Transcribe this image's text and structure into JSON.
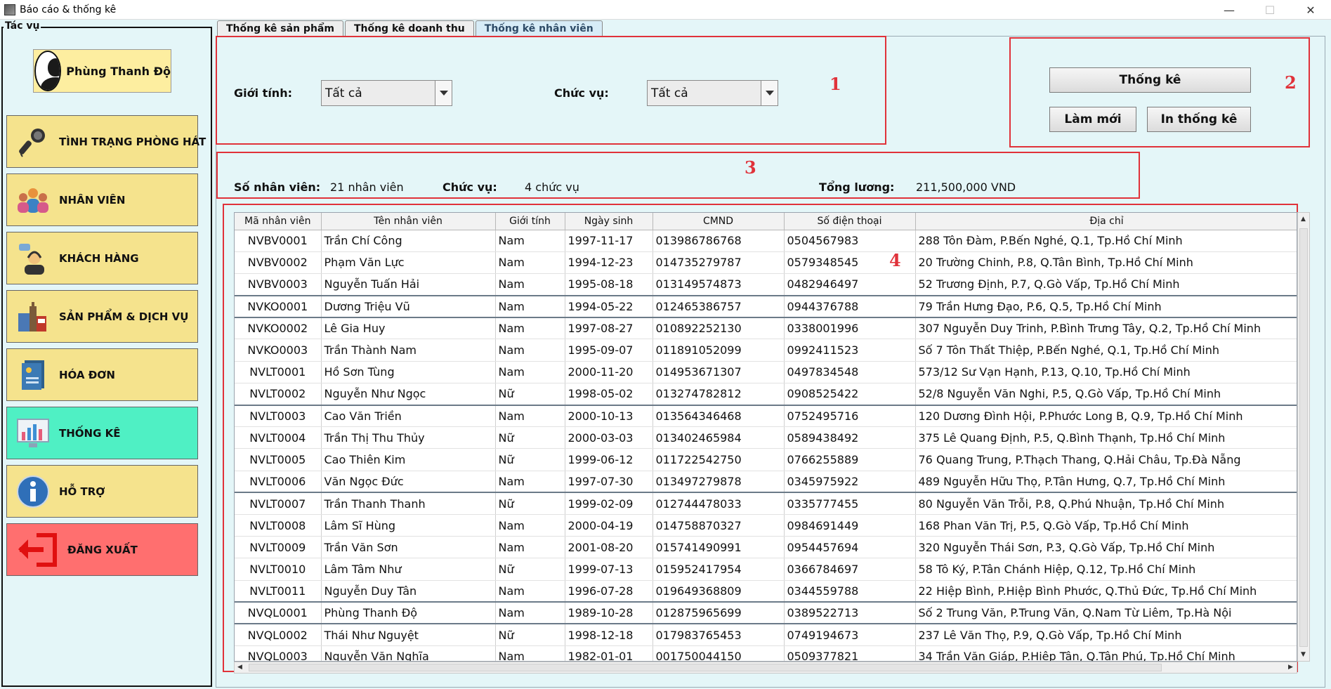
{
  "window": {
    "title": "Báo cáo & thống kê",
    "minimize": "—",
    "maximize": "☐",
    "close": "✕"
  },
  "sidebar": {
    "legend": "Tác vụ",
    "user_name": "Phùng Thanh Độ",
    "items": [
      {
        "label": "TÌNH TRẠNG PHÒNG HÁT",
        "icon": "microphone-icon"
      },
      {
        "label": "NHÂN VIÊN",
        "icon": "staff-group-icon"
      },
      {
        "label": "KHÁCH HÀNG",
        "icon": "customer-support-icon"
      },
      {
        "label": "SẢN PHẨM & DỊCH VỤ",
        "icon": "products-icon"
      },
      {
        "label": "HÓA ĐƠN",
        "icon": "invoice-icon"
      },
      {
        "label": "THỐNG KÊ",
        "icon": "statistics-chart-icon"
      },
      {
        "label": "HỖ TRỢ",
        "icon": "info-icon"
      },
      {
        "label": "ĐĂNG XUẤT",
        "icon": "logout-icon"
      }
    ]
  },
  "tabs": [
    {
      "label": "Thống kê sản phẩm",
      "active": false
    },
    {
      "label": "Thống kê doanh thu",
      "active": false
    },
    {
      "label": "Thống kê nhân viên",
      "active": true
    }
  ],
  "filters": {
    "gender_label": "Giới tính:",
    "gender_value": "Tất cả",
    "position_label": "Chức vụ:",
    "position_value": "Tất cả"
  },
  "annotations": {
    "n1": "1",
    "n2": "2",
    "n3": "3",
    "n4": "4"
  },
  "actions": {
    "stats_label": "Thống kê",
    "refresh_label": "Làm mới",
    "print_label": "In thống kê"
  },
  "summary": {
    "employees_label": "Số nhân viên:",
    "employees_value": "21 nhân viên",
    "positions_label": "Chức vụ:",
    "positions_value": "4 chức vụ",
    "salary_label": "Tổng lương:",
    "salary_value": "211,500,000 VND"
  },
  "table": {
    "headers": [
      "Mã nhân viên",
      "Tên nhân viên",
      "Giới tính",
      "Ngày sinh",
      "CMND",
      "Số điện thoại",
      "Địa chỉ"
    ],
    "rows": [
      [
        "NVBV0001",
        "Trần Chí Công",
        "Nam",
        "1997-11-17",
        "013986786768",
        "0504567983",
        "288 Tôn Đàm, P.Bến Nghé, Q.1, Tp.Hồ Chí Minh"
      ],
      [
        "NVBV0002",
        "Phạm Văn Lực",
        "Nam",
        "1994-12-23",
        "014735279787",
        "0579348545",
        "20 Trường Chinh, P.8, Q.Tân Bình, Tp.Hồ Chí Minh"
      ],
      [
        "NVBV0003",
        "Nguyễn Tuấn Hải",
        "Nam",
        "1995-08-18",
        "013149574873",
        "0482946497",
        "52 Trương Định, P.7, Q.Gò Vấp, Tp.Hồ Chí Minh"
      ],
      [
        "NVKO0001",
        "Dương Triệu Vũ",
        "Nam",
        "1994-05-22",
        "012465386757",
        "0944376788",
        "79 Trần Hưng Đạo, P.6, Q.5, Tp.Hồ Chí Minh"
      ],
      [
        "NVKO0002",
        "Lê Gia Huy",
        "Nam",
        "1997-08-27",
        "010892252130",
        "0338001996",
        "307 Nguyễn Duy Trinh, P.Bình Trưng Tây, Q.2, Tp.Hồ Chí Minh"
      ],
      [
        "NVKO0003",
        "Trần Thành Nam",
        "Nam",
        "1995-09-07",
        "011891052099",
        "0992411523",
        "Số 7 Tôn Thất Thiệp, P.Bến Nghé, Q.1, Tp.Hồ Chí Minh"
      ],
      [
        "NVLT0001",
        "Hồ Sơn Tùng",
        "Nam",
        "2000-11-20",
        "014953671307",
        "0497834548",
        "573/12 Sư Vạn Hạnh, P.13, Q.10, Tp.Hồ Chí Minh"
      ],
      [
        "NVLT0002",
        "Nguyễn Như Ngọc",
        "Nữ",
        "1998-05-02",
        "013274782812",
        "0908525422",
        "52/8 Nguyễn Văn Nghi, P.5, Q.Gò Vấp, Tp.Hồ Chí Minh"
      ],
      [
        "NVLT0003",
        "Cao Văn Triền",
        "Nam",
        "2000-10-13",
        "013564346468",
        "0752495716",
        "120 Dương Đình Hội, P.Phước Long B, Q.9, Tp.Hồ Chí Minh"
      ],
      [
        "NVLT0004",
        "Trần Thị Thu Thủy",
        "Nữ",
        "2000-03-03",
        "013402465984",
        "0589438492",
        "375 Lê Quang Định, P.5, Q.Bình Thạnh, Tp.Hồ Chí Minh"
      ],
      [
        "NVLT0005",
        "Cao Thiên Kim",
        "Nữ",
        "1999-06-12",
        "011722542750",
        "0766255889",
        "76 Quang Trung, P.Thạch Thang, Q.Hải Châu, Tp.Đà Nẵng"
      ],
      [
        "NVLT0006",
        "Văn Ngọc Đức",
        "Nam",
        "1997-07-30",
        "013497279878",
        "0345975922",
        "489 Nguyễn Hữu Thọ, P.Tân Hưng, Q.7, Tp.Hồ Chí Minh"
      ],
      [
        "NVLT0007",
        "Trần Thanh Thanh",
        "Nữ",
        "1999-02-09",
        "012744478033",
        "0335777455",
        "80 Nguyễn Văn Trỗi, P.8, Q.Phú Nhuận, Tp.Hồ Chí Minh"
      ],
      [
        "NVLT0008",
        "Lâm Sĩ Hùng",
        "Nam",
        "2000-04-19",
        "014758870327",
        "0984691449",
        "168 Phan Văn Trị, P.5, Q.Gò Vấp, Tp.Hồ Chí Minh"
      ],
      [
        "NVLT0009",
        "Trần Văn Sơn",
        "Nam",
        "2001-08-20",
        "015741490991",
        "0954457694",
        "320 Nguyễn Thái Sơn, P.3, Q.Gò Vấp, Tp.Hồ Chí Minh"
      ],
      [
        "NVLT0010",
        "Lâm Tâm Như",
        "Nữ",
        "1999-07-13",
        "015952417954",
        "0366784697",
        "58 Tô Ký, P.Tân Chánh Hiệp, Q.12, Tp.Hồ Chí Minh"
      ],
      [
        "NVLT0011",
        "Nguyễn Duy Tân",
        "Nam",
        "1996-07-28",
        "019649368809",
        "0344559788",
        "22 Hiệp Bình, P.Hiệp Bình Phước, Q.Thủ Đức, Tp.Hồ Chí Minh"
      ],
      [
        "NVQL0001",
        "Phùng Thanh Độ",
        "Nam",
        "1989-10-28",
        "012875965699",
        "0389522713",
        "Số 2 Trung Văn, P.Trung Văn, Q.Nam Từ Liêm, Tp.Hà Nội"
      ],
      [
        "NVQL0002",
        "Thái Như Nguyệt",
        "Nữ",
        "1998-12-18",
        "017983765453",
        "0749194673",
        "237 Lê Văn Thọ, P.9, Q.Gò Vấp, Tp.Hồ Chí Minh"
      ],
      [
        "NVQL0003",
        "Nguyễn Văn Nghĩa",
        "Nam",
        "1982-01-01",
        "001750044150",
        "0509377821",
        "34 Trần Văn Giáp, P.Hiệp Tân, Q.Tân Phú, Tp.Hồ Chí Minh"
      ]
    ]
  }
}
